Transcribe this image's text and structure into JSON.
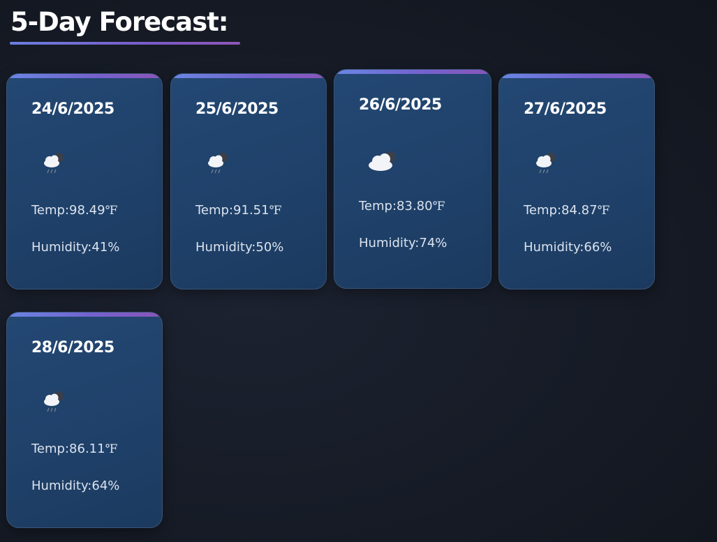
{
  "title": "5-Day Forecast:",
  "forecast": [
    {
      "date": "24/6/2025",
      "icon": "cloud-rain-night-icon",
      "temp_label": "Temp:98.49",
      "temp_unit": "℉",
      "humidity_label": "Humidity:41%"
    },
    {
      "date": "25/6/2025",
      "icon": "cloud-rain-night-icon",
      "temp_label": "Temp:91.51",
      "temp_unit": "℉",
      "humidity_label": "Humidity:50%"
    },
    {
      "date": "26/6/2025",
      "icon": "cloud-night-icon",
      "temp_label": "Temp:83.80",
      "temp_unit": "℉",
      "humidity_label": "Humidity:74%"
    },
    {
      "date": "27/6/2025",
      "icon": "cloud-rain-night-icon",
      "temp_label": "Temp:84.87",
      "temp_unit": "℉",
      "humidity_label": "Humidity:66%"
    },
    {
      "date": "28/6/2025",
      "icon": "cloud-rain-night-icon",
      "temp_label": "Temp:86.11",
      "temp_unit": "℉",
      "humidity_label": "Humidity:64%"
    }
  ],
  "colors": {
    "background": "#161b26",
    "card": "#234873",
    "card_border": "#3b5477",
    "accent_start": "#6a86e3",
    "accent_end": "#8a55b9",
    "text": "#dbe3ee"
  }
}
